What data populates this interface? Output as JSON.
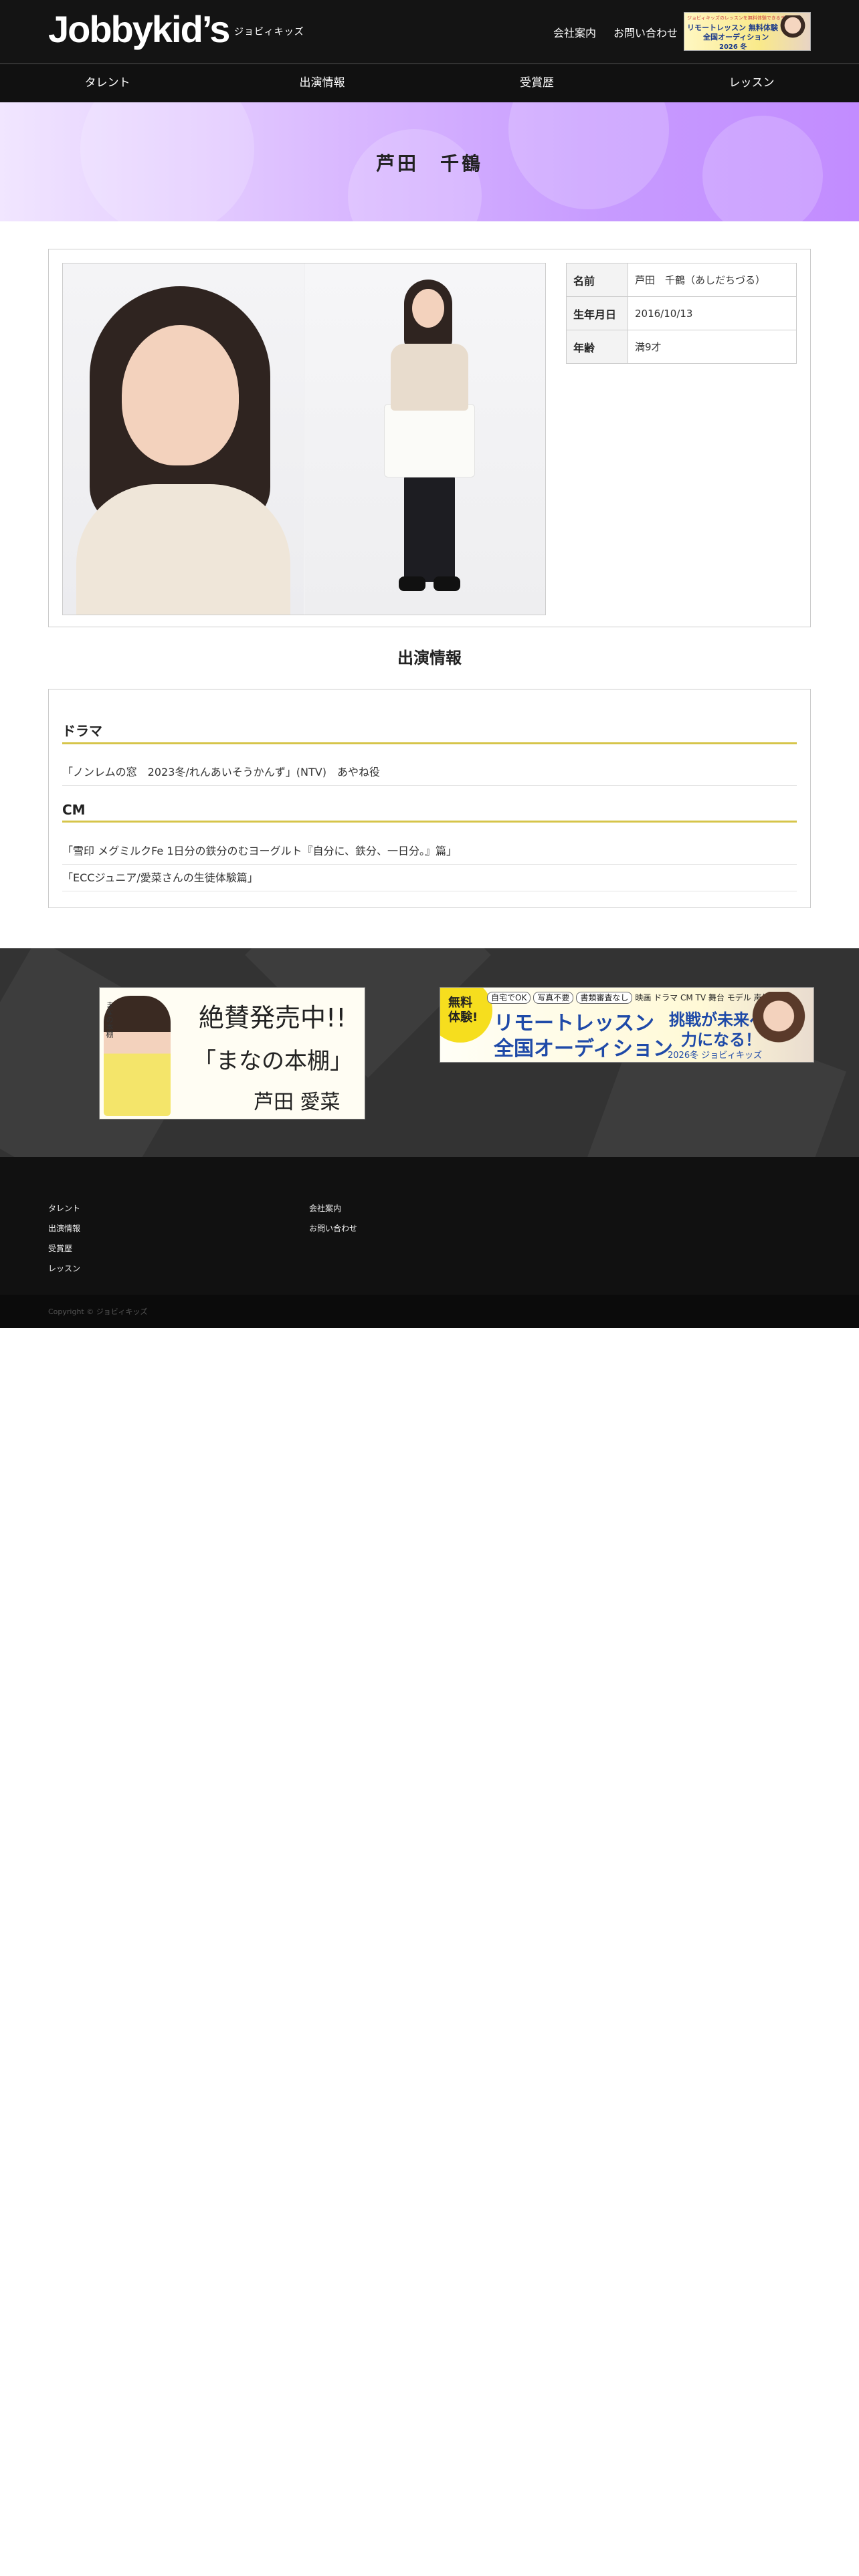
{
  "header": {
    "logo_text": "Jobbykid’s",
    "logo_sub": "ジョビィキッズ",
    "nav": [
      "会社案内",
      "お問い合わせ"
    ],
    "banner": {
      "line1": "ジョビィキッズのレッスンを無料体験できるチャンス！",
      "line2": "リモートレッスン 無料体験",
      "line3": "全国オーディション",
      "line4": "2026 冬"
    }
  },
  "main_nav": [
    "タレント",
    "出演情報",
    "受賞歴",
    "レッスン"
  ],
  "hero": {
    "title": "芦田　千鶴"
  },
  "profile": {
    "rows": [
      {
        "label": "名前",
        "value": "芦田　千鶴（あしだちづる）"
      },
      {
        "label": "生年月日",
        "value": "2016/10/13"
      },
      {
        "label": "年齢",
        "value": "満9才"
      }
    ]
  },
  "performance": {
    "title": "出演情報",
    "categories": [
      {
        "name": "ドラマ",
        "items": [
          "「ノンレムの窓　2023冬/れんあいそうかんず」(NTV)　あやね役"
        ]
      },
      {
        "name": "CM",
        "items": [
          "「雪印 メグミルクFe 1日分の鉄分のむヨーグルト『自分に、鉄分、一日分。』篇」",
          "「ECCジュニア/愛菜さんの生徒体験篇」"
        ]
      }
    ]
  },
  "banners": {
    "book": {
      "vertical": "まなの本棚",
      "line1": "絶賛発売中!!",
      "line2": "「まなの本棚」",
      "line3": "芦田 愛菜"
    },
    "audition": {
      "free": "無料体験!",
      "tags": [
        "自宅でOK",
        "写真不要",
        "書類審査なし",
        "映画 ドラマ CM TV 舞台 モデル 声優"
      ],
      "main1": "リモートレッスン",
      "main2": "全国オーディション",
      "catch1": "挑戦が未来への",
      "catch2": "力になる！",
      "season": "2026冬 ジョビィキッズ"
    }
  },
  "footer": {
    "col1": [
      "タレント",
      "出演情報",
      "受賞歴",
      "レッスン"
    ],
    "col2": [
      "会社案内",
      "お問い合わせ"
    ],
    "copyright": "Copyright © ジョビィキッズ"
  }
}
